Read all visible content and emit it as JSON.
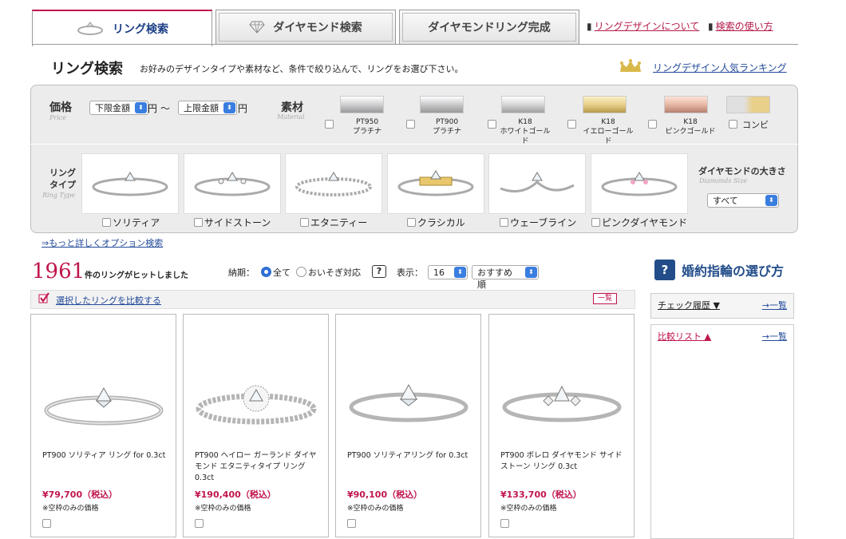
{
  "tabs": [
    {
      "label": "リング検索",
      "icon": "ring-icon",
      "active": true
    },
    {
      "label": "ダイヤモンド検索",
      "icon": "diamond-icon",
      "active": false
    },
    {
      "label": "ダイヤモンドリング完成",
      "icon": "",
      "active": false
    }
  ],
  "top_links": {
    "about_design": "リングデザインについて",
    "how_to_search": "検索の使い方"
  },
  "header": {
    "title": "リング検索",
    "subtitle": "お好みのデザインタイプや素材など、条件で絞り込んで、リングをお選び下さい。",
    "ranking_link": "リングデザイン人気ランキング"
  },
  "filters": {
    "price": {
      "label": "価格",
      "label_en": "Price",
      "min": "下限金額",
      "max": "上限金額",
      "unit": "円",
      "sep": "〜"
    },
    "material": {
      "label": "素材",
      "label_en": "Material",
      "options": [
        {
          "line1": "PT950",
          "line2": "プラチナ",
          "color": "#cfd0d2"
        },
        {
          "line1": "PT900",
          "line2": "プラチナ",
          "color": "#c8c9cb"
        },
        {
          "line1": "K18",
          "line2": "ホワイトゴールド",
          "color": "#d5d5d5"
        },
        {
          "line1": "K18",
          "line2": "イエローゴールド",
          "color": "#e8cf8a"
        },
        {
          "line1": "K18",
          "line2": "ピンクゴールド",
          "color": "#e8b7a4"
        },
        {
          "line1": "",
          "line2": "コンビ",
          "color": "#ddd2a4"
        }
      ]
    },
    "ring_type": {
      "label_1": "リング",
      "label_2": "タイプ",
      "label_en": "Ring Type",
      "options": [
        "ソリティア",
        "サイドストーン",
        "エタニティー",
        "クラシカル",
        "ウェーブライン",
        "ピンクダイヤモンド"
      ]
    },
    "diamond_size": {
      "label": "ダイヤモンドの大きさ",
      "label_en": "Diamonds Size",
      "value": "すべて"
    },
    "more_options": "⇒もっと詳しくオプション検索"
  },
  "results": {
    "count": "1961",
    "count_text": "件のリングがヒットしました",
    "delivery_label": "納期：",
    "delivery_all": "全て",
    "delivery_rush": "おいそぎ対応",
    "help": "?",
    "display_label": "表示：",
    "per_page": "16",
    "sort": "おすすめ順",
    "compare_link": "選択したリングを比較する",
    "list_button": "一覧"
  },
  "products": [
    {
      "name": "PT900 ソリティア リング for 0.3ct",
      "price": "¥79,700（税込）",
      "note": "※空枠のみの価格"
    },
    {
      "name": "PT900 ヘイロー ガーランド ダイヤモンド エタニティタイプ リング 0.3ct",
      "price": "¥190,400（税込）",
      "note": "※空枠のみの価格"
    },
    {
      "name": "PT900 ソリティアリング for 0.3ct",
      "price": "¥90,100（税込）",
      "note": "※空枠のみの価格"
    },
    {
      "name": "PT900 ボレロ ダイヤモンド サイドストーン リング 0.3ct",
      "price": "¥133,700（税込）",
      "note": "※空枠のみの価格"
    }
  ],
  "sidebar": {
    "guide_q": "?",
    "guide_title": "婚約指輪の選び方",
    "history": "チェック履歴 ▼",
    "history_link": "→一覧",
    "compare": "比較リスト ▲",
    "compare_link": "→一覧"
  },
  "colors": {
    "accent": "#c0154b",
    "link": "#224a99",
    "navy": "#234d8a"
  }
}
